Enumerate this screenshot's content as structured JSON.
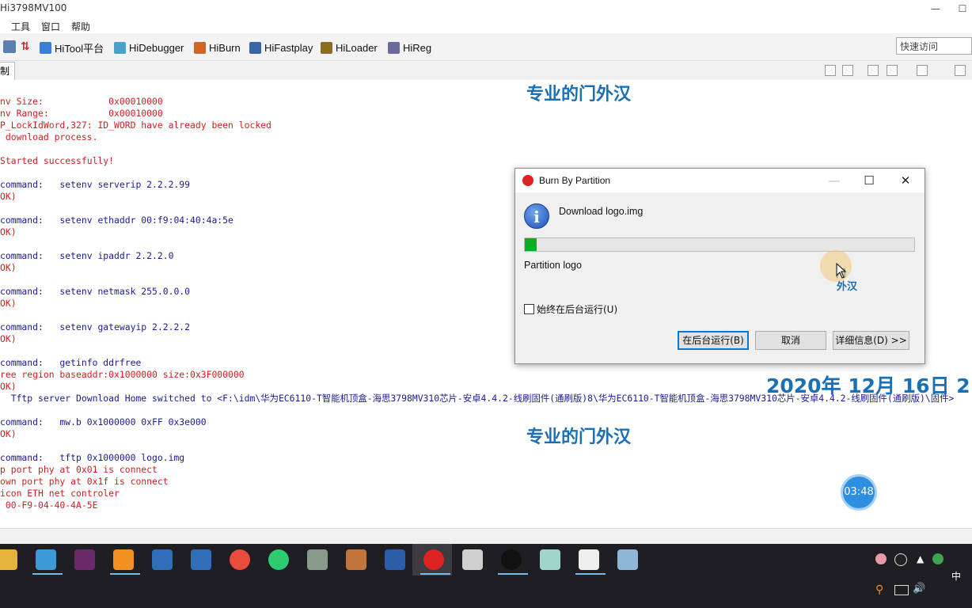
{
  "window": {
    "title": "Hi3798MV100",
    "controls": [
      "—",
      "☐"
    ]
  },
  "menu": {
    "items": [
      "工具",
      "窗口",
      "帮助"
    ]
  },
  "toolbar": {
    "items": [
      {
        "label": "HiTool平台",
        "icon": "home-icon",
        "color": "#3b7dd8"
      },
      {
        "label": "HiDebugger",
        "icon": "bug-icon",
        "color": "#4aa0c8"
      },
      {
        "label": "HiBurn",
        "icon": "flame-icon",
        "color": "#d9631e"
      },
      {
        "label": "HiFastplay",
        "icon": "monitor-icon",
        "color": "#3a64a8"
      },
      {
        "label": "HiLoader",
        "icon": "loader-icon",
        "color": "#8a6d1f"
      },
      {
        "label": "HiReg",
        "icon": "register-icon",
        "color": "#6b6b9b"
      }
    ],
    "quick_access_placeholder": "快速访问"
  },
  "tab": {
    "label": "制台"
  },
  "console": {
    "lines": [
      {
        "text": "nv Size:            0x00010000",
        "style": "red"
      },
      {
        "text": "nv Range:           0x00010000",
        "style": "red"
      },
      {
        "text": "P_LockIdWord,327: ID_WORD have already been locked",
        "style": "red"
      },
      {
        "text": " download process.",
        "style": "red"
      },
      {
        "text": "",
        "style": "red"
      },
      {
        "text": "Started successfully!",
        "style": "red"
      },
      {
        "text": "",
        "style": "red"
      },
      {
        "text": "command:   setenv serverip 2.2.2.99",
        "style": "blue"
      },
      {
        "text": "OK)",
        "style": "red"
      },
      {
        "text": "",
        "style": "red"
      },
      {
        "text": "command:   setenv ethaddr 00:f9:04:40:4a:5e",
        "style": "blue"
      },
      {
        "text": "OK)",
        "style": "red"
      },
      {
        "text": "",
        "style": "red"
      },
      {
        "text": "command:   setenv ipaddr 2.2.2.0",
        "style": "blue"
      },
      {
        "text": "OK)",
        "style": "red"
      },
      {
        "text": "",
        "style": "red"
      },
      {
        "text": "command:   setenv netmask 255.0.0.0",
        "style": "blue"
      },
      {
        "text": "OK)",
        "style": "red"
      },
      {
        "text": "",
        "style": "red"
      },
      {
        "text": "command:   setenv gatewayip 2.2.2.2",
        "style": "blue"
      },
      {
        "text": "OK)",
        "style": "red"
      },
      {
        "text": "",
        "style": "red"
      },
      {
        "text": "command:   getinfo ddrfree",
        "style": "blue"
      },
      {
        "text": "ree region baseaddr:0x1000000 size:0x3F000000",
        "style": "red"
      },
      {
        "text": "OK)",
        "style": "red"
      },
      {
        "text": "  Tftp server Download Home switched to <F:\\idm\\华为EC6110-T智能机顶盒-海思3798MV310芯片-安卓4.4.2-线刷固件(通刷版)8\\华为EC6110-T智能机顶盒-海思3798MV310芯片-安卓4.4.2-线刷固件(通刷版)\\固件>",
        "style": "blue"
      },
      {
        "text": "",
        "style": "red"
      },
      {
        "text": "command:   mw.b 0x1000000 0xFF 0x3e000",
        "style": "blue"
      },
      {
        "text": "OK)",
        "style": "red"
      },
      {
        "text": "",
        "style": "red"
      },
      {
        "text": "command:   tftp 0x1000000 logo.img",
        "style": "blue"
      },
      {
        "text": "p port phy at 0x01 is connect",
        "style": "red"
      },
      {
        "text": "own port phy at 0x1f is connect",
        "style": "red"
      },
      {
        "text": "icon ETH net controler",
        "style": "red"
      },
      {
        "text": " 00-F9-04-40-4A-5E",
        "style": "red"
      }
    ]
  },
  "watermark": {
    "top": "专业的门外汉",
    "middle": "专业的门外汉",
    "date": "2020年 12月 16日 2",
    "small_top": "门",
    "small_bottom": "外汉"
  },
  "dialog": {
    "title": "Burn By Partition",
    "message": "Download logo.img",
    "progress": 0.03,
    "partition_label": "Partition logo",
    "checkbox_label": "始终在后台运行(U)",
    "checkbox_checked": false,
    "buttons": {
      "background": "在后台运行(B)",
      "cancel": "取消",
      "details": "详细信息(D) >>"
    },
    "controls": {
      "minimize": "—",
      "maximize": "☐",
      "close": "✕"
    }
  },
  "timer": "03:48",
  "taskbar": {
    "apps": [
      "file-explorer-icon",
      "network-icon",
      "media-icon",
      "search-tool-icon",
      "window-app-icon",
      "window-app-2-icon",
      "chrome-icon",
      "play-icon",
      "settings-icon",
      "archive-icon",
      "network-share-icon",
      "hitool-icon",
      "file-icon",
      "obs-icon",
      "flower-icon",
      "7zip-icon",
      "notepad-icon"
    ],
    "ime": "中"
  },
  "colors": {
    "console_red": "#cc1f1f",
    "console_blue": "#1b1b8f",
    "watermark": "#1a6fb5",
    "progress": "#06b025",
    "taskbar": "#1f1f23"
  }
}
